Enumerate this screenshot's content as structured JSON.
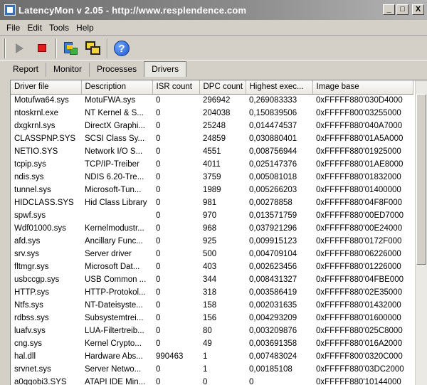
{
  "window": {
    "title": "LatencyMon v 2.05 - http://www.resplendence.com"
  },
  "window_controls": {
    "minimize": "_",
    "maximize": "□",
    "close": "X"
  },
  "menu": [
    "File",
    "Edit",
    "Tools",
    "Help"
  ],
  "toolbar": {
    "buttons": [
      "start-icon",
      "stop-icon",
      "cpu-icon",
      "windows-icon",
      "help-icon"
    ],
    "help_glyph": "?"
  },
  "tabs": [
    "Report",
    "Monitor",
    "Processes",
    "Drivers"
  ],
  "active_tab": "Drivers",
  "table": {
    "columns": [
      "Driver file",
      "Description",
      "ISR count",
      "DPC count",
      "Highest exec...",
      "Image base"
    ],
    "rows": [
      [
        "Motufwa64.sys",
        "MotuFWA.sys",
        "0",
        "296942",
        "0,269083333",
        "0xFFFFF880'030D4000"
      ],
      [
        "ntoskrnl.exe",
        "NT Kernel & S...",
        "0",
        "204038",
        "0,150839506",
        "0xFFFFF800'03255000"
      ],
      [
        "dxgkrnl.sys",
        "DirectX Graphi...",
        "0",
        "25248",
        "0,014474537",
        "0xFFFFF880'040A7000"
      ],
      [
        "CLASSPNP.SYS",
        "SCSI Class Sy...",
        "0",
        "24859",
        "0,030880401",
        "0xFFFFF880'01A5A000"
      ],
      [
        "NETIO.SYS",
        "Network I/O S...",
        "0",
        "4551",
        "0,008756944",
        "0xFFFFF880'01925000"
      ],
      [
        "tcpip.sys",
        "TCP/IP-Treiber",
        "0",
        "4011",
        "0,025147376",
        "0xFFFFF880'01AE8000"
      ],
      [
        "ndis.sys",
        "NDIS 6.20-Tre...",
        "0",
        "3759",
        "0,005081018",
        "0xFFFFF880'01832000"
      ],
      [
        "tunnel.sys",
        "Microsoft-Tun...",
        "0",
        "1989",
        "0,005266203",
        "0xFFFFF880'01400000"
      ],
      [
        "HIDCLASS.SYS",
        "Hid Class Library",
        "0",
        "981",
        "0,00278858",
        "0xFFFFF880'04F8F000"
      ],
      [
        "spwf.sys",
        "",
        "0",
        "970",
        "0,013571759",
        "0xFFFFF880'00ED7000"
      ],
      [
        "Wdf01000.sys",
        "Kernelmodustr...",
        "0",
        "968",
        "0,037921296",
        "0xFFFFF880'00E24000"
      ],
      [
        "afd.sys",
        "Ancillary Func...",
        "0",
        "925",
        "0,009915123",
        "0xFFFFF880'0172F000"
      ],
      [
        "srv.sys",
        "Server driver",
        "0",
        "500",
        "0,004709104",
        "0xFFFFF880'06226000"
      ],
      [
        "fltmgr.sys",
        "Microsoft Dat...",
        "0",
        "403",
        "0,002623456",
        "0xFFFFF880'01226000"
      ],
      [
        "usbccgp.sys",
        "USB Common ...",
        "0",
        "344",
        "0,008431327",
        "0xFFFFF880'04FBE000"
      ],
      [
        "HTTP.sys",
        "HTTP-Protokol...",
        "0",
        "318",
        "0,003586419",
        "0xFFFFF880'02E35000"
      ],
      [
        "Ntfs.sys",
        "NT-Dateisyste...",
        "0",
        "158",
        "0,002031635",
        "0xFFFFF880'01432000"
      ],
      [
        "rdbss.sys",
        "Subsystemtrei...",
        "0",
        "156",
        "0,004293209",
        "0xFFFFF880'01600000"
      ],
      [
        "luafv.sys",
        "LUA-Filtertreib...",
        "0",
        "80",
        "0,003209876",
        "0xFFFFF880'025C8000"
      ],
      [
        "cng.sys",
        "Kernel Crypto...",
        "0",
        "49",
        "0,003691358",
        "0xFFFFF880'016A2000"
      ],
      [
        "hal.dll",
        "Hardware Abs...",
        "990463",
        "1",
        "0,007483024",
        "0xFFFFF800'0320C000"
      ],
      [
        "srvnet.sys",
        "Server Netwo...",
        "0",
        "1",
        "0,00185108",
        "0xFFFFF880'03DC2000"
      ],
      [
        "a0qqobi3.SYS",
        "ATAPI IDE Min...",
        "0",
        "0",
        "0",
        "0xFFFFF880'10144000"
      ]
    ]
  }
}
